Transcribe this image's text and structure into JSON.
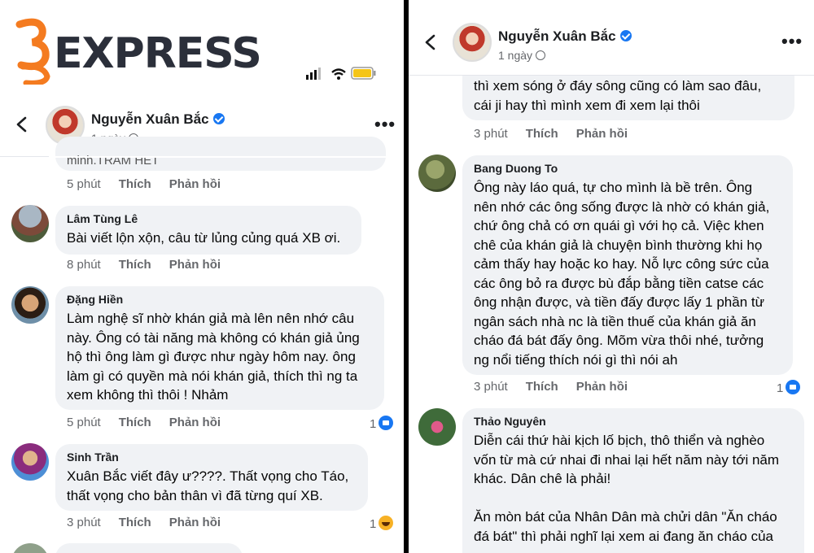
{
  "watermark": {
    "logo_text": "EXPRESS"
  },
  "left": {
    "header": {
      "name": "Nguyễn Xuân Bắc",
      "time": "1 ngày"
    },
    "partial_comment": {
      "text": "minh.TRAM HET",
      "time": "5 phút"
    },
    "comments": [
      {
        "name": "Lâm Tùng Lê",
        "text": "Bài viết lộn xộn, câu từ lủng củng quá XB ơi.",
        "time": "8 phút",
        "reaction_count": ""
      },
      {
        "name": "Đặng Hiền",
        "text": "Làm nghệ sĩ nhờ khán giả mà lên nên nhớ câu\nnày. Ông có tài năng mà không có khán giả ủng\nhộ thì ông làm gì được như ngày hôm nay. ông\nlàm gì có quyền mà nói khán giả, thích thì ng ta\nxem không thì thôi ! Nhảm",
        "time": "5 phút",
        "reaction_count": "1"
      },
      {
        "name": "Sinh Trần",
        "text": "Xuân Bắc viết đây ư????. Thất vọng cho Táo,\nthất vọng cho bản thân vì đã từng quí XB.",
        "time": "3 phút",
        "reaction_count": "1"
      }
    ]
  },
  "right": {
    "header": {
      "name": "Nguyễn Xuân Bắc",
      "time": "1 ngày"
    },
    "partial_comment": {
      "text": "thì xem sóng ở đáy sông cũng có làm sao đâu,\ncái ji hay thì mình xem đi xem lại thôi",
      "time": "3 phút"
    },
    "comments": [
      {
        "name": "Bang Duong To",
        "text": "Ông này láo quá, tự cho mình là bề trên. Ông\nnên nhớ các ông sống được là nhờ có khán giả,\nchứ ông chả có ơn quái gì với họ cả. Việc khen\nchê của khán giả là chuyện bình thường khi họ\ncảm thấy hay hoặc ko hay. Nỗ lực công sức của\ncác ông bỏ ra được bù đắp bằng tiền catse các\nông nhận được, và tiền đấy được lấy 1 phần từ\nngân sách nhà nc là tiền thuế của khán giả ăn\ncháo đá bát đấy ông. Mõm vừa thôi nhé, tưởng\nng nổi tiếng thích nói gì thì nói ah",
        "time": "3 phút",
        "reaction_count": "1"
      },
      {
        "name": "Thảo Nguyên",
        "text": "Diễn cái thứ hài kịch lố bịch, thô thiển và nghèo\nvốn từ mà cứ nhai đi nhai lại hết năm này tới năm\nkhác. Dân chê là phải!\n\nĂn mòn bát của Nhân Dân mà chửi dân \"Ăn cháo\nđá bát\" thì phải nghĩ lại xem ai đang ăn cháo của",
        "time": "",
        "reaction_count": ""
      }
    ]
  },
  "actions": {
    "like": "Thích",
    "reply": "Phản hồi"
  },
  "colors": {
    "accent": "#1877f2",
    "bubble": "#f0f2f5",
    "meta": "#65676b",
    "logo_orange": "#f47b20",
    "logo_dark": "#2b2f3a"
  }
}
